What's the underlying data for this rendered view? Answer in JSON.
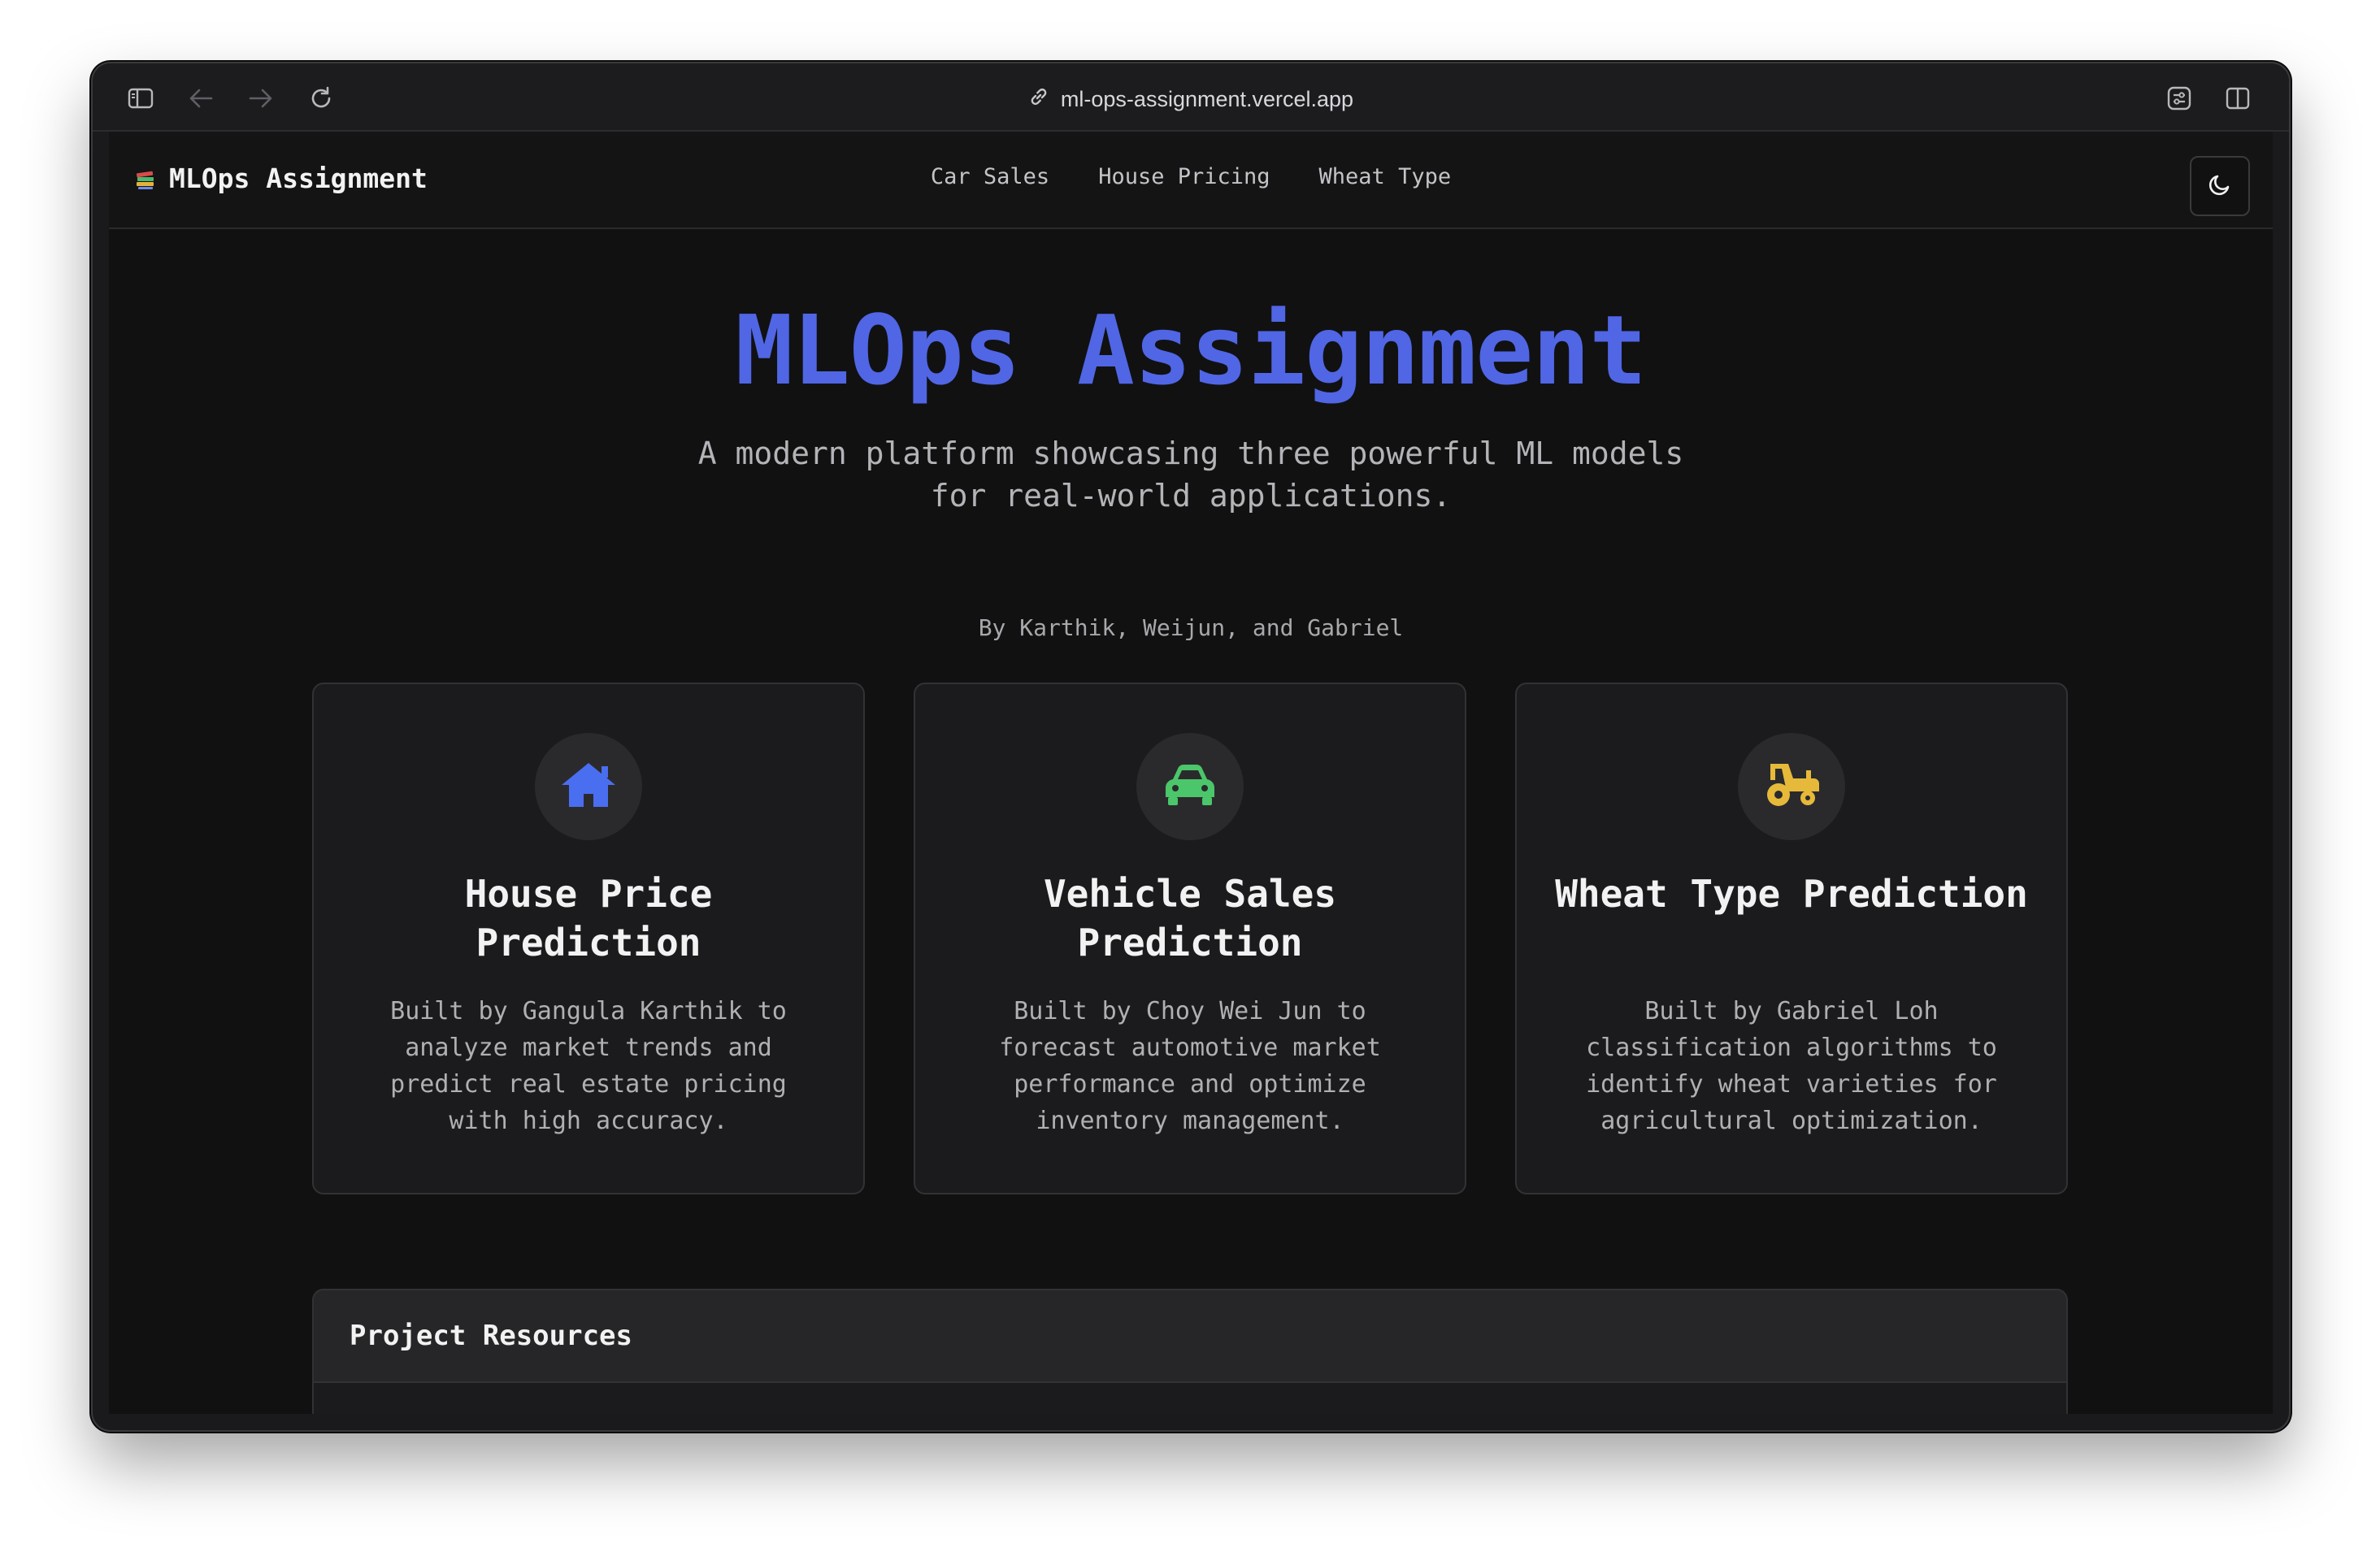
{
  "browser": {
    "url": "ml-ops-assignment.vercel.app"
  },
  "navbar": {
    "brand": "MLOps Assignment",
    "links": [
      "Car Sales",
      "House Pricing",
      "Wheat Type"
    ]
  },
  "hero": {
    "title": "MLOps Assignment",
    "subtitle": "A modern platform showcasing three powerful ML models for real-world applications.",
    "authors": "By Karthik, Weijun, and Gabriel"
  },
  "cards": [
    {
      "icon": "house-icon",
      "color": "#4a6ef0",
      "title": "House Price Prediction",
      "description": "Built by Gangula Karthik to analyze market trends and predict real estate pricing with high accuracy."
    },
    {
      "icon": "car-icon",
      "color": "#4bc66a",
      "title": "Vehicle Sales Prediction",
      "description": "Built by Choy Wei Jun to forecast automotive market performance and optimize inventory management."
    },
    {
      "icon": "tractor-icon",
      "color": "#e6b93a",
      "title": "Wheat Type Prediction",
      "description": "Built by Gabriel Loh classification algorithms to identify wheat varieties for agricultural optimization."
    }
  ],
  "resources": {
    "title": "Project Resources"
  },
  "colors": {
    "accent": "#5066e4",
    "background": "#111112",
    "card": "#1b1b1d"
  }
}
